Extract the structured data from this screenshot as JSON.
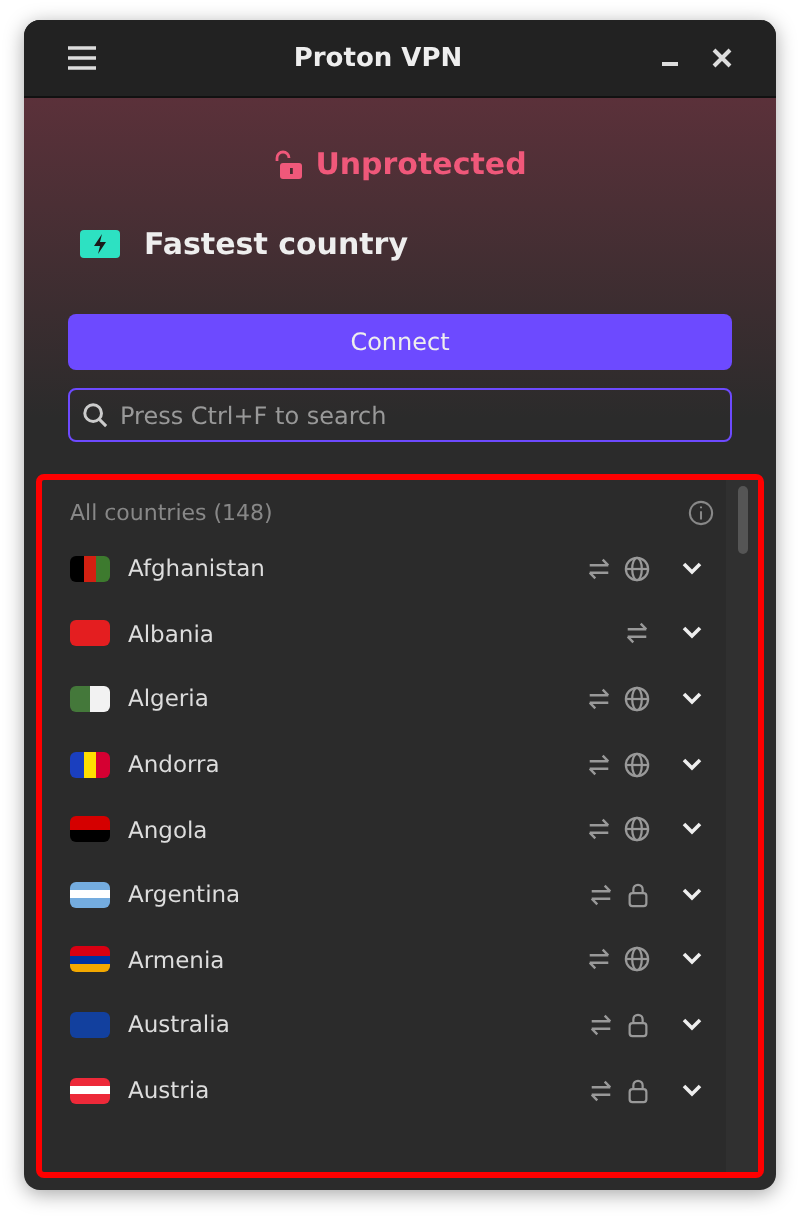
{
  "window": {
    "title": "Proton VPN"
  },
  "status": {
    "label": "Unprotected",
    "protected": false
  },
  "profile": {
    "label": "Fastest country"
  },
  "connect_button": {
    "label": "Connect"
  },
  "search": {
    "placeholder": "Press Ctrl+F to search"
  },
  "list": {
    "header": "All countries (148)",
    "countries": [
      {
        "name": "Afghanistan",
        "flag": {
          "kind": "vertical",
          "stripes": [
            {
              "color": "#000000"
            },
            {
              "color": "#d32011"
            },
            {
              "color": "#3d7a2e"
            }
          ]
        },
        "features": [
          {
            "kind": "p2p"
          },
          {
            "kind": "globe"
          }
        ]
      },
      {
        "name": "Albania",
        "flag": {
          "kind": "horizontal",
          "stripes": [
            {
              "color": "#e41e20"
            }
          ]
        },
        "features": [
          {
            "kind": "p2p"
          }
        ]
      },
      {
        "name": "Algeria",
        "flag": {
          "kind": "vertical",
          "stripes": [
            {
              "color": "#44783a"
            },
            {
              "color": "#f2f2f2"
            }
          ]
        },
        "features": [
          {
            "kind": "p2p"
          },
          {
            "kind": "globe"
          }
        ]
      },
      {
        "name": "Andorra",
        "flag": {
          "kind": "vertical",
          "stripes": [
            {
              "color": "#1a3fbf"
            },
            {
              "color": "#fedf00"
            },
            {
              "color": "#d50032"
            }
          ]
        },
        "features": [
          {
            "kind": "p2p"
          },
          {
            "kind": "globe"
          }
        ]
      },
      {
        "name": "Angola",
        "flag": {
          "kind": "horizontal",
          "stripes": [
            {
              "color": "#d50000"
            },
            {
              "color": "#000000"
            }
          ]
        },
        "features": [
          {
            "kind": "p2p"
          },
          {
            "kind": "globe"
          }
        ]
      },
      {
        "name": "Argentina",
        "flag": {
          "kind": "horizontal",
          "stripes": [
            {
              "color": "#74acdf"
            },
            {
              "color": "#ffffff"
            },
            {
              "color": "#74acdf"
            }
          ]
        },
        "features": [
          {
            "kind": "p2p"
          },
          {
            "kind": "lock"
          }
        ]
      },
      {
        "name": "Armenia",
        "flag": {
          "kind": "horizontal",
          "stripes": [
            {
              "color": "#d90012"
            },
            {
              "color": "#0033a0"
            },
            {
              "color": "#f2a800"
            }
          ]
        },
        "features": [
          {
            "kind": "p2p"
          },
          {
            "kind": "globe"
          }
        ]
      },
      {
        "name": "Australia",
        "flag": {
          "kind": "horizontal",
          "stripes": [
            {
              "color": "#12409e"
            }
          ]
        },
        "features": [
          {
            "kind": "p2p"
          },
          {
            "kind": "lock"
          }
        ]
      },
      {
        "name": "Austria",
        "flag": {
          "kind": "horizontal",
          "stripes": [
            {
              "color": "#ed2939"
            },
            {
              "color": "#ffffff"
            },
            {
              "color": "#ed2939"
            }
          ]
        },
        "features": [
          {
            "kind": "p2p"
          },
          {
            "kind": "lock"
          }
        ]
      }
    ]
  }
}
